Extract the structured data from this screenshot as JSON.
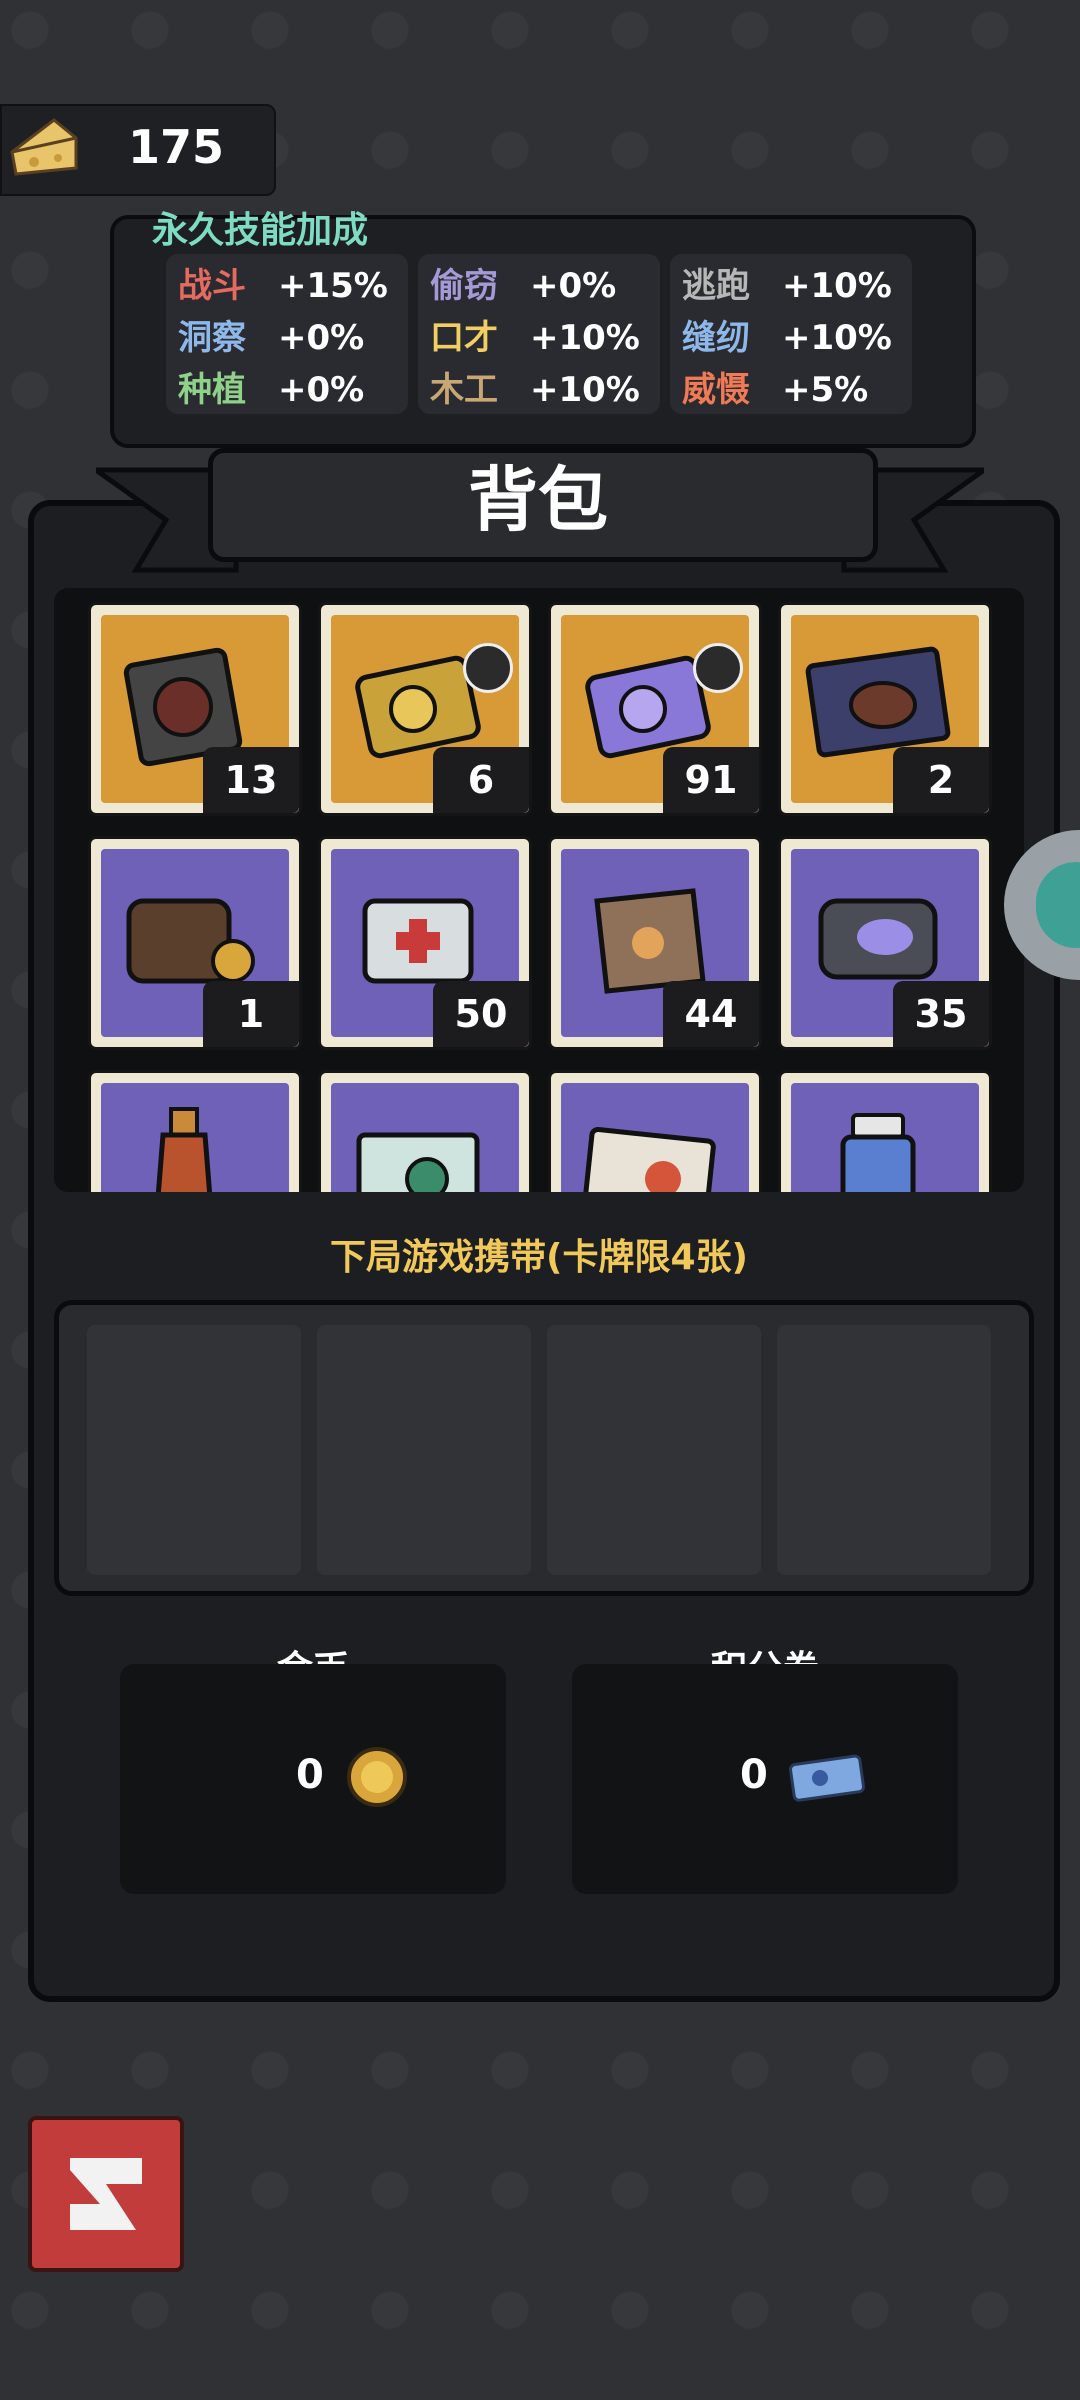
{
  "currency": {
    "cheese": "175"
  },
  "skills": {
    "title": "永久技能加成",
    "groups": [
      [
        {
          "name": "战斗",
          "value": "+15%"
        },
        {
          "name": "洞察",
          "value": "+0%"
        },
        {
          "name": "种植",
          "value": "+0%"
        }
      ],
      [
        {
          "name": "偷窃",
          "value": "+0%"
        },
        {
          "name": "口才",
          "value": "+10%"
        },
        {
          "name": "木工",
          "value": "+10%"
        }
      ],
      [
        {
          "name": "逃跑",
          "value": "+10%"
        },
        {
          "name": "缝纫",
          "value": "+10%"
        },
        {
          "name": "威慑",
          "value": "+5%"
        }
      ]
    ]
  },
  "backpack": {
    "title": "背包",
    "items": [
      {
        "name": "cassette-pack",
        "count": "13",
        "bg": "orange"
      },
      {
        "name": "gold-card-pack",
        "count": "6",
        "bg": "orange"
      },
      {
        "name": "purple-card-pack",
        "count": "91",
        "bg": "orange"
      },
      {
        "name": "steak-meal",
        "count": "2",
        "bg": "orange"
      },
      {
        "name": "wallet-coins",
        "count": "1",
        "bg": "purple"
      },
      {
        "name": "first-aid-kit",
        "count": "50",
        "bg": "purple"
      },
      {
        "name": "paper-bag",
        "count": "44",
        "bg": "purple"
      },
      {
        "name": "blob-case",
        "count": "35",
        "bg": "purple"
      },
      {
        "name": "sauce-bottle",
        "count": "",
        "bg": "purple"
      },
      {
        "name": "virus-box",
        "count": "",
        "bg": "purple"
      },
      {
        "name": "fire-book",
        "count": "",
        "bg": "purple"
      },
      {
        "name": "pill-bottle",
        "count": "",
        "bg": "purple"
      }
    ]
  },
  "carry": {
    "label": "下局游戏携带(卡牌限4张)"
  },
  "wallet": {
    "gold_label": "金币",
    "gold_value": "0",
    "points_label": "积分券",
    "points_value": "0"
  },
  "colors": {
    "orange_card": "#d79a37",
    "purple_card": "#6f61b8",
    "accent": "#f0c95a"
  }
}
